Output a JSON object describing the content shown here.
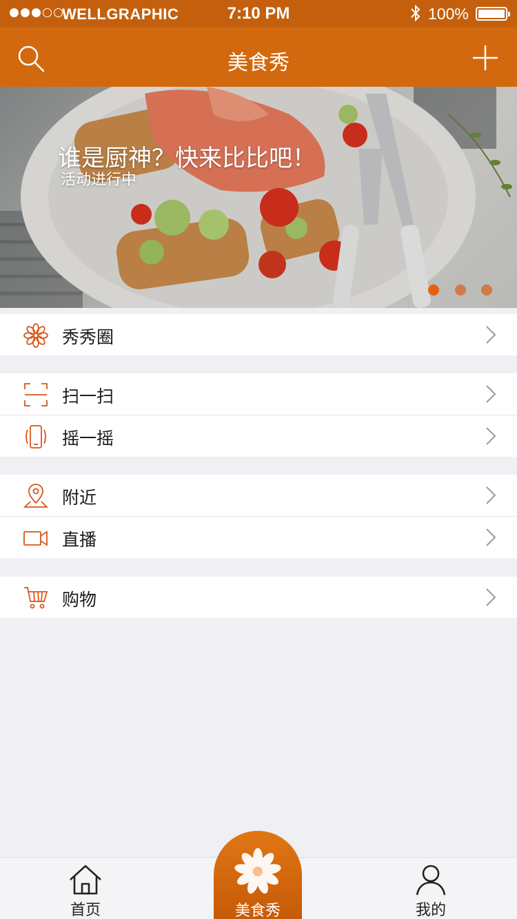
{
  "status_bar": {
    "carrier": "WELLGRAPHIC",
    "time": "7:10 PM",
    "battery": "100%"
  },
  "nav": {
    "title": "美食秀",
    "search_icon": "search-icon",
    "add_icon": "plus-icon"
  },
  "banner": {
    "headline": "谁是厨神？快来比比吧！",
    "subtitle": "活动进行中",
    "page_count": 3,
    "active_page": 1
  },
  "menu": {
    "groups": [
      {
        "items": [
          {
            "label": "秀秀圈",
            "icon": "flower-icon"
          }
        ]
      },
      {
        "items": [
          {
            "label": "扫一扫",
            "icon": "scan-icon"
          },
          {
            "label": "摇一摇",
            "icon": "shake-phone-icon"
          }
        ]
      },
      {
        "items": [
          {
            "label": "附近",
            "icon": "location-pin-icon"
          },
          {
            "label": "直播",
            "icon": "video-camera-icon"
          }
        ]
      },
      {
        "items": [
          {
            "label": "购物",
            "icon": "shopping-cart-icon"
          }
        ]
      }
    ]
  },
  "tab_bar": {
    "tabs": [
      {
        "label": "首页",
        "icon": "home-icon"
      },
      {
        "label": "美食秀",
        "icon": "flower-icon",
        "active": true
      },
      {
        "label": "我的",
        "icon": "person-icon"
      }
    ]
  },
  "colors": {
    "accent": "#d2690f",
    "status_bar": "#c4600d",
    "background": "#efeff4",
    "dot_active": "#e2620f",
    "dot_inactive": "#d27a45"
  }
}
